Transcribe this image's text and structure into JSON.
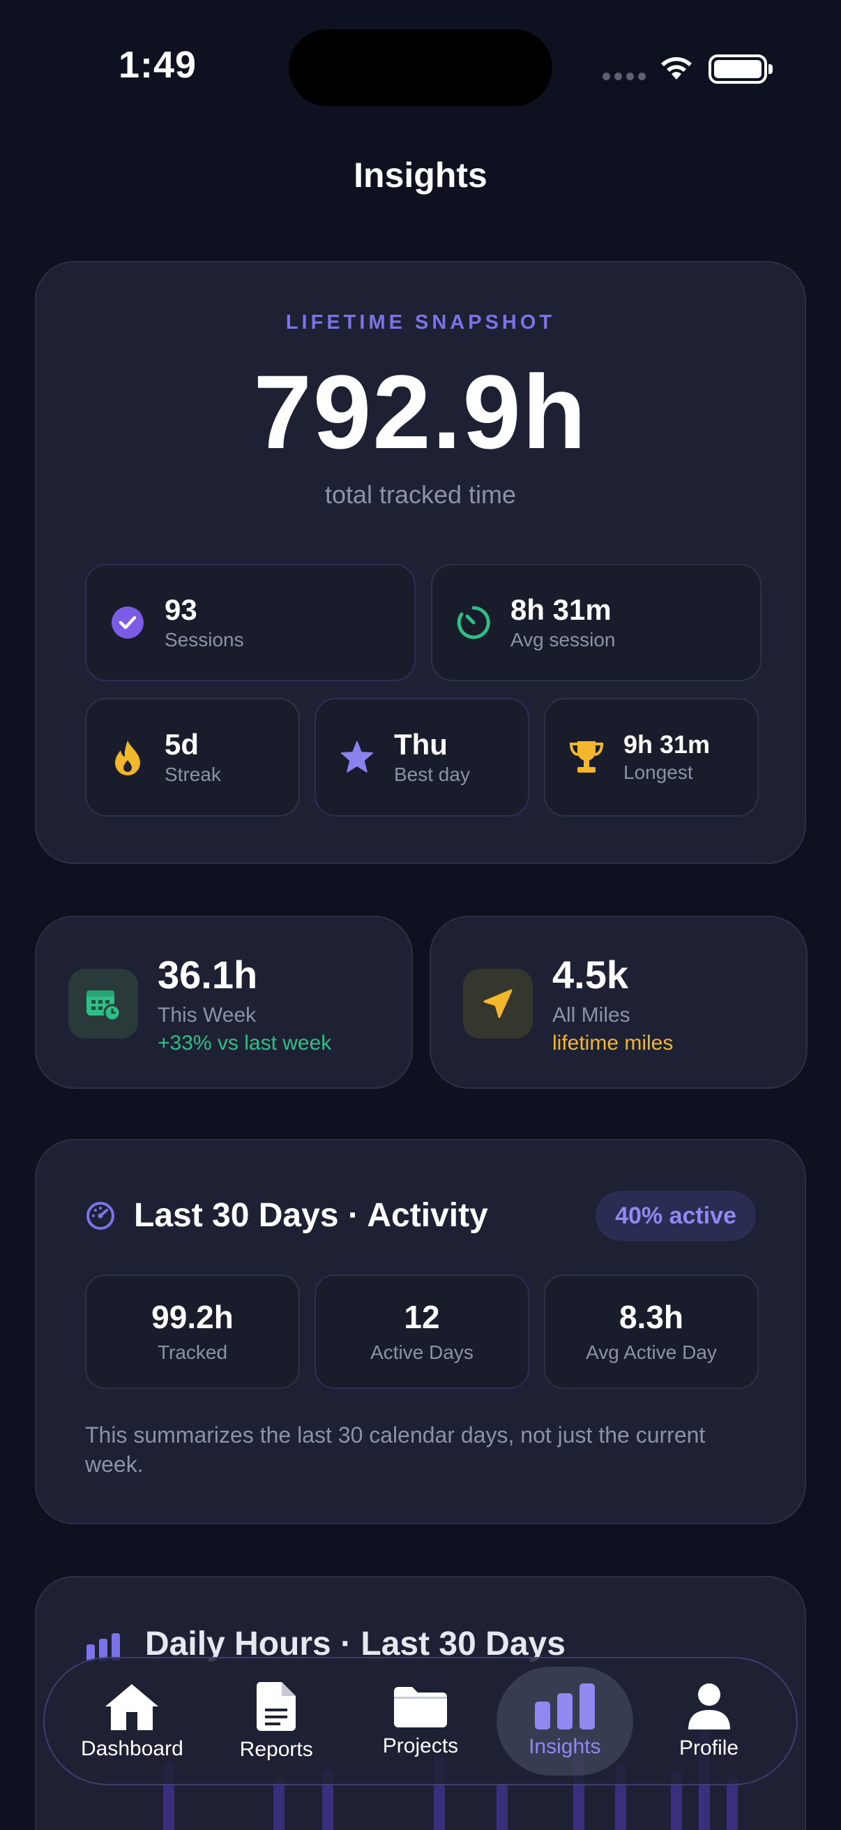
{
  "status": {
    "time": "1:49"
  },
  "title": "Insights",
  "lifetime": {
    "label": "LIFETIME SNAPSHOT",
    "value": "792.9h",
    "subtitle": "total tracked time",
    "stats": [
      {
        "value": "93",
        "label": "Sessions",
        "icon": "check-circle-icon"
      },
      {
        "value": "8h 31m",
        "label": "Avg session",
        "icon": "timer-icon"
      },
      {
        "value": "5d",
        "label": "Streak",
        "icon": "flame-icon"
      },
      {
        "value": "Thu",
        "label": "Best day",
        "icon": "star-icon"
      },
      {
        "value": "9h 31m",
        "label": "Longest",
        "icon": "trophy-icon"
      }
    ]
  },
  "week": {
    "value": "36.1h",
    "label": "This Week",
    "sub": "+33% vs last week"
  },
  "miles": {
    "value": "4.5k",
    "label": "All Miles",
    "sub": "lifetime miles"
  },
  "last30": {
    "title": "Last 30 Days · Activity",
    "badge": "40% active",
    "stats": [
      {
        "value": "99.2h",
        "label": "Tracked"
      },
      {
        "value": "12",
        "label": "Active Days"
      },
      {
        "value": "8.3h",
        "label": "Avg Active Day"
      }
    ],
    "note": "This summarizes the last 30 calendar days, not just the current week."
  },
  "daily": {
    "title": "Daily Hours · Last 30 Days"
  },
  "tabs": [
    {
      "label": "Dashboard",
      "icon": "home-icon"
    },
    {
      "label": "Reports",
      "icon": "document-icon"
    },
    {
      "label": "Projects",
      "icon": "folder-icon"
    },
    {
      "label": "Insights",
      "icon": "bar-chart-icon",
      "active": true
    },
    {
      "label": "Profile",
      "icon": "person-icon"
    }
  ],
  "colors": {
    "background": "#0d1120",
    "card": "#1d2133",
    "accent": "#7b74e8",
    "green": "#2fbf86",
    "orange": "#f3b72b"
  }
}
